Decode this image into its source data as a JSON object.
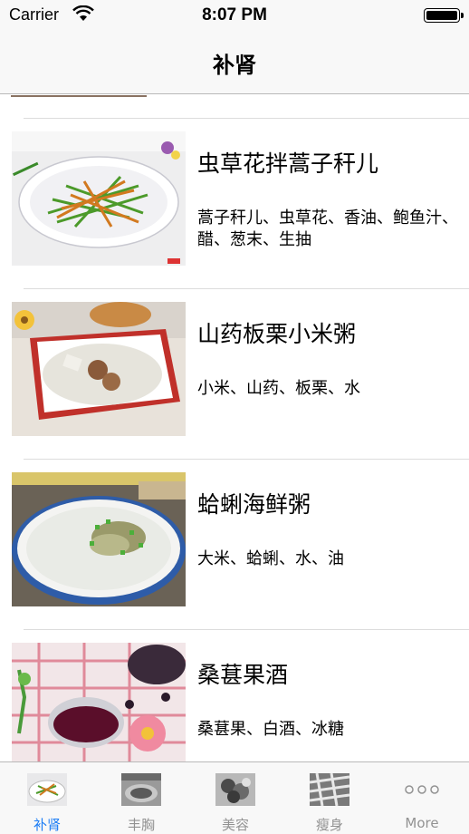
{
  "status_bar": {
    "carrier": "Carrier",
    "time": "8:07 PM"
  },
  "nav": {
    "title": "补肾"
  },
  "recipes": [
    {
      "title": "虫草花拌蒿子秆儿",
      "ingredients": "蒿子秆儿、虫草花、香油、鲍鱼汁、醋、葱末、生抽"
    },
    {
      "title": "山药板栗小米粥",
      "ingredients": "小米、山药、板栗、水"
    },
    {
      "title": "蛤蜊海鲜粥",
      "ingredients": "大米、蛤蜊、水、油"
    },
    {
      "title": "桑葚果酒",
      "ingredients": "桑葚果、白酒、冰糖"
    }
  ],
  "tabs": [
    {
      "label": "补肾",
      "icon": "salad-dish-photo-icon",
      "active": true
    },
    {
      "label": "丰胸",
      "icon": "food-photo-icon",
      "active": false
    },
    {
      "label": "美容",
      "icon": "food-photo-icon",
      "active": false
    },
    {
      "label": "瘦身",
      "icon": "food-photo-icon",
      "active": false
    },
    {
      "label": "More",
      "icon": "more-icon",
      "active": false
    }
  ],
  "colors": {
    "accent": "#1a7cf5",
    "inactive": "#929292",
    "bar_background": "#f8f8f8"
  }
}
